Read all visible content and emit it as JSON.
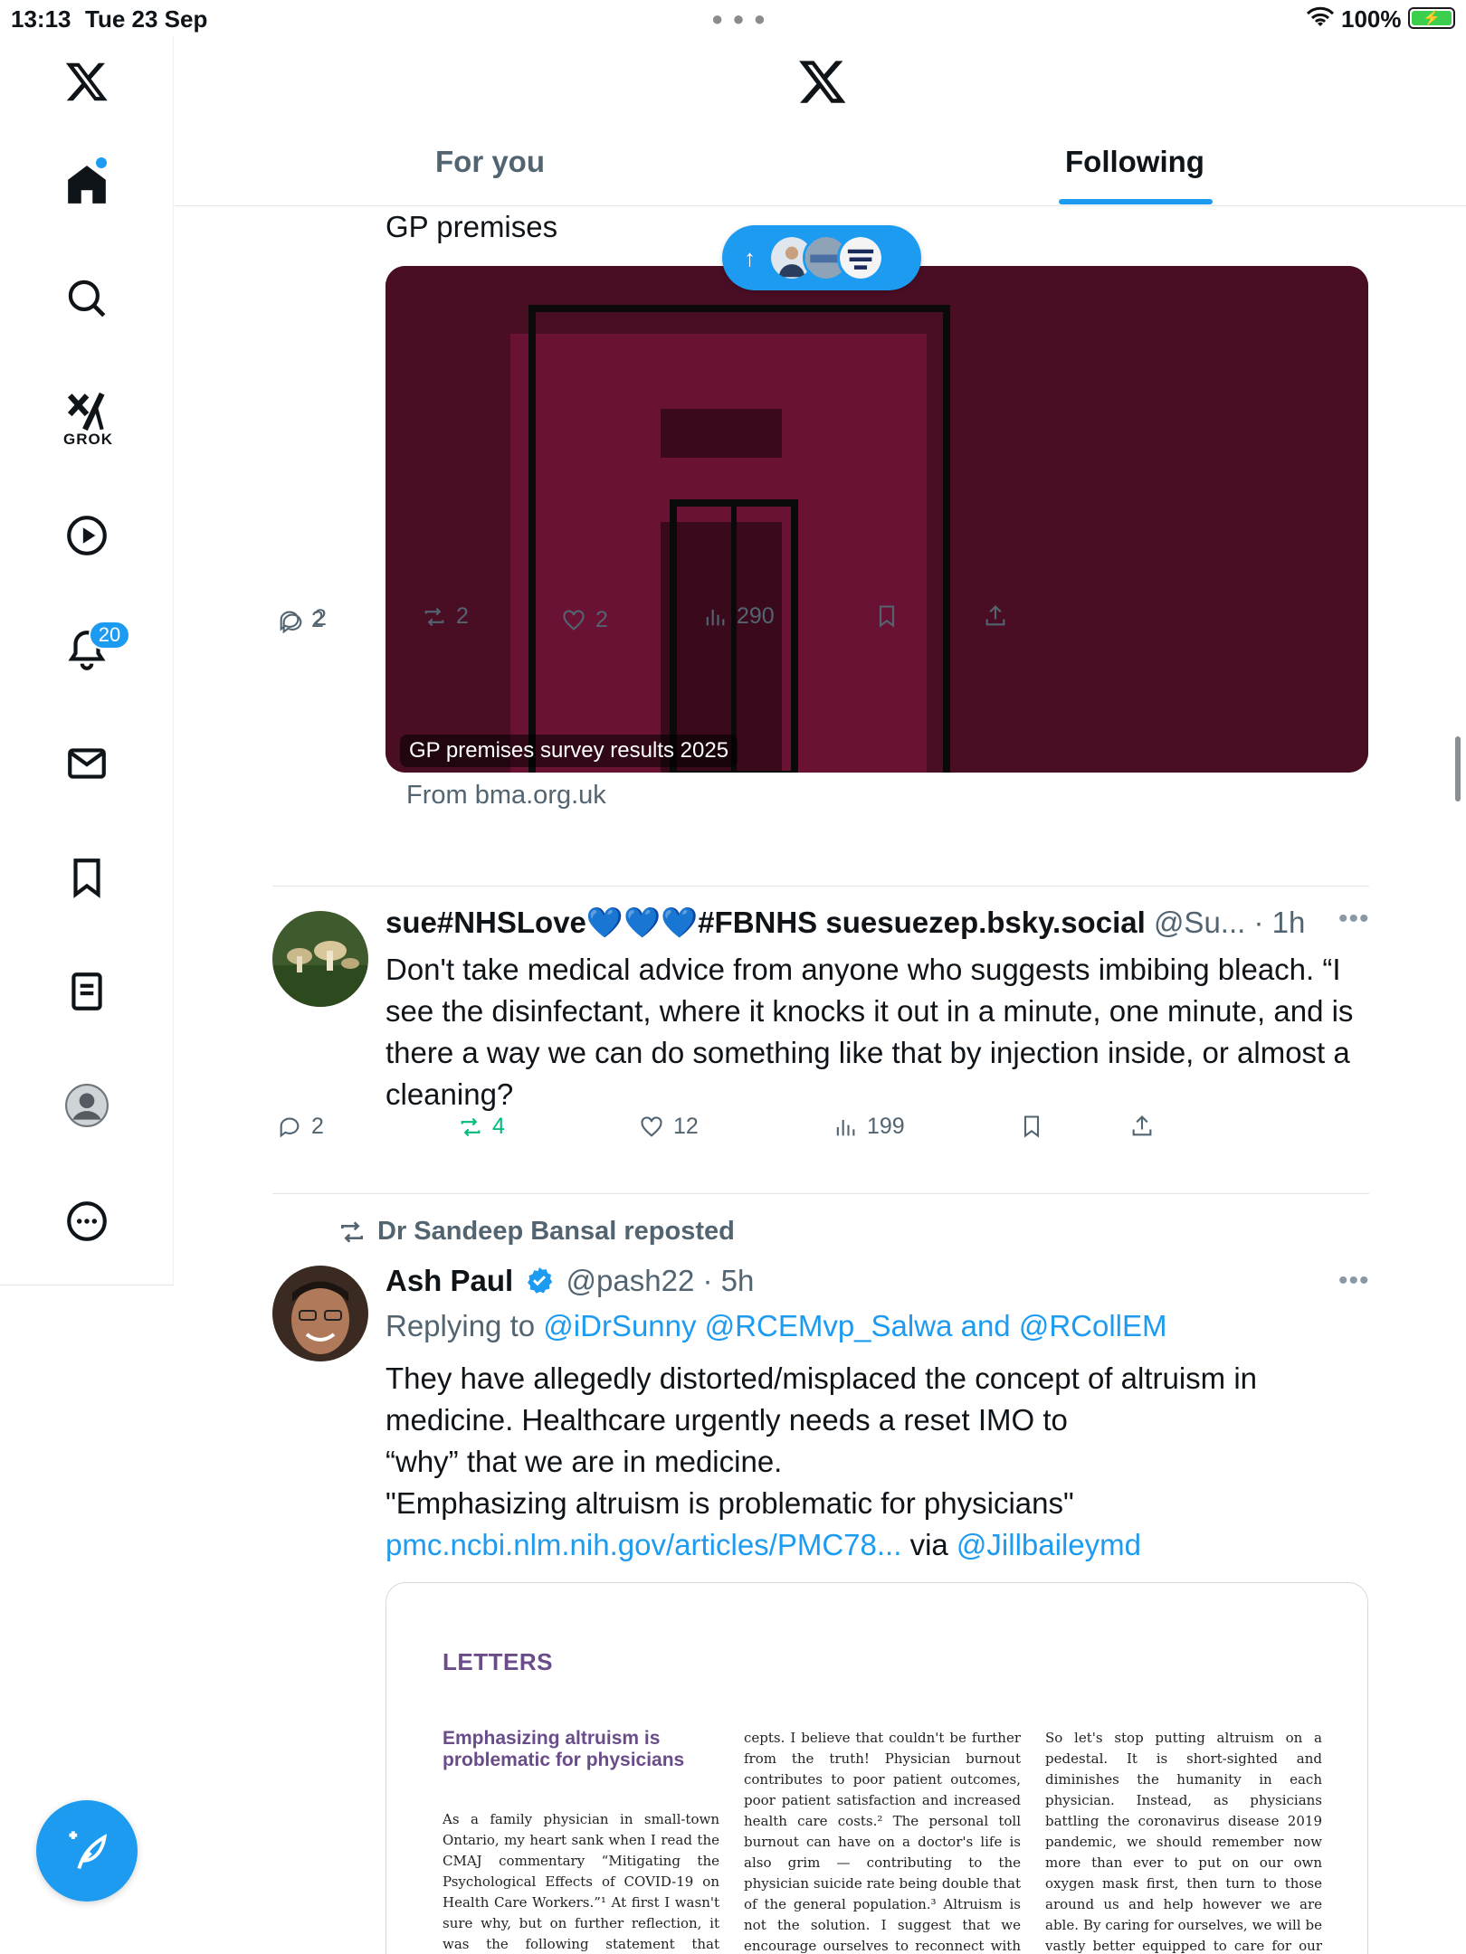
{
  "status_bar": {
    "time": "13:13",
    "date": "Tue 23 Sep",
    "battery": "100%"
  },
  "sidebar": {
    "items": [
      {
        "name": "x-logo",
        "icon": "x-logo-icon"
      },
      {
        "name": "home",
        "icon": "home-icon"
      },
      {
        "name": "explore",
        "icon": "search-icon"
      },
      {
        "name": "grok",
        "icon": "grok-icon",
        "label": "GROK"
      },
      {
        "name": "video",
        "icon": "play-icon"
      },
      {
        "name": "notifications",
        "icon": "bell-icon",
        "badge": "20"
      },
      {
        "name": "messages",
        "icon": "mail-icon"
      },
      {
        "name": "bookmarks",
        "icon": "bookmark-icon"
      },
      {
        "name": "articles",
        "icon": "document-icon"
      },
      {
        "name": "profile",
        "icon": "avatar-icon"
      },
      {
        "name": "more",
        "icon": "more-circle-icon"
      }
    ],
    "compose_icon": "compose-feather-icon"
  },
  "header": {
    "tabs": [
      {
        "label": "For you",
        "active": false
      },
      {
        "label": "Following",
        "active": true
      }
    ]
  },
  "feed": {
    "card_post": {
      "title": "GP premises",
      "image_caption": "GP premises survey results 2025",
      "from": "From bma.org.uk",
      "replies": "2",
      "reposts": "2",
      "likes": "2",
      "views": "290"
    },
    "new_posts_pill": {
      "arrow": "↑"
    },
    "post_sue": {
      "name": "sue#NHSLove💙💙💙#FBNHS suesuezep.bsky.social",
      "handle_time": "@Su... · 1h",
      "text": "Don't take medical advice from anyone who suggests imbibing bleach. “I see the disinfectant, where it knocks it out in a minute, one minute, and is there a way we can do something like that by injection inside, or almost a cleaning?",
      "replies": "2",
      "reposts": "4",
      "likes": "12",
      "views": "199"
    },
    "post_ash": {
      "reposted_by": "Dr Sandeep Bansal reposted",
      "name": "Ash Paul",
      "handle_time": "@pash22 · 5h",
      "replying_prefix": "Replying to",
      "replying_to": "@iDrSunny @RCEMvp_Salwa",
      "replying_and": "and",
      "replying_last": "@RCollEM",
      "text_1": "They have allegedly distorted/misplaced the concept of altruism in medicine. Healthcare urgently needs a reset IMO to",
      "text_2": "“why” that we are in medicine.",
      "text_3": "\"Emphasizing altruism is problematic for physicians\"",
      "link": "pmc.ncbi.nlm.nih.gov/articles/PMC78...",
      "via": "via",
      "via_handle": "@Jillbaileymd",
      "letter": {
        "heading": "LETTERS",
        "title": "Emphasizing altruism is problematic for physicians",
        "col1": "As a family physician in small-town Ontario, my heart sank when I read the CMAJ commentary “Mitigating the Psychological Effects of COVID-19 on Health Care Workers.”¹ At first I wasn't sure why, but on further reflection, it was the following statement that worried me: “Emphasizing the altruism of working in health care and",
        "col2": "cepts. I believe that couldn't be further from the truth! Physician burnout contributes to poor patient outcomes, poor patient satisfaction and increased health care costs.² The personal toll burnout can have on a doctor's life is also grim — contributing to the physician suicide rate being double that of the general population.³ Altruism is not the solution. I suggest that we encourage ourselves to reconnect with meaning, our “why” that we are in medicine.",
        "col3": "So let's stop putting altruism on a pedestal. It is short-sighted and diminishes the humanity in each physician. Instead, as physicians battling the coronavirus disease 2019 pandemic, we should remember now more than ever to put on our own oxygen mask first, then turn to those around us and help however we are able. By caring for ourselves, we will be vastly better equipped to care for our patients."
      }
    }
  },
  "colors": {
    "accent": "#1d9bf0",
    "repost_active": "#00ba7c",
    "muted": "#536471",
    "card_image_bg": "#4a0e24"
  }
}
